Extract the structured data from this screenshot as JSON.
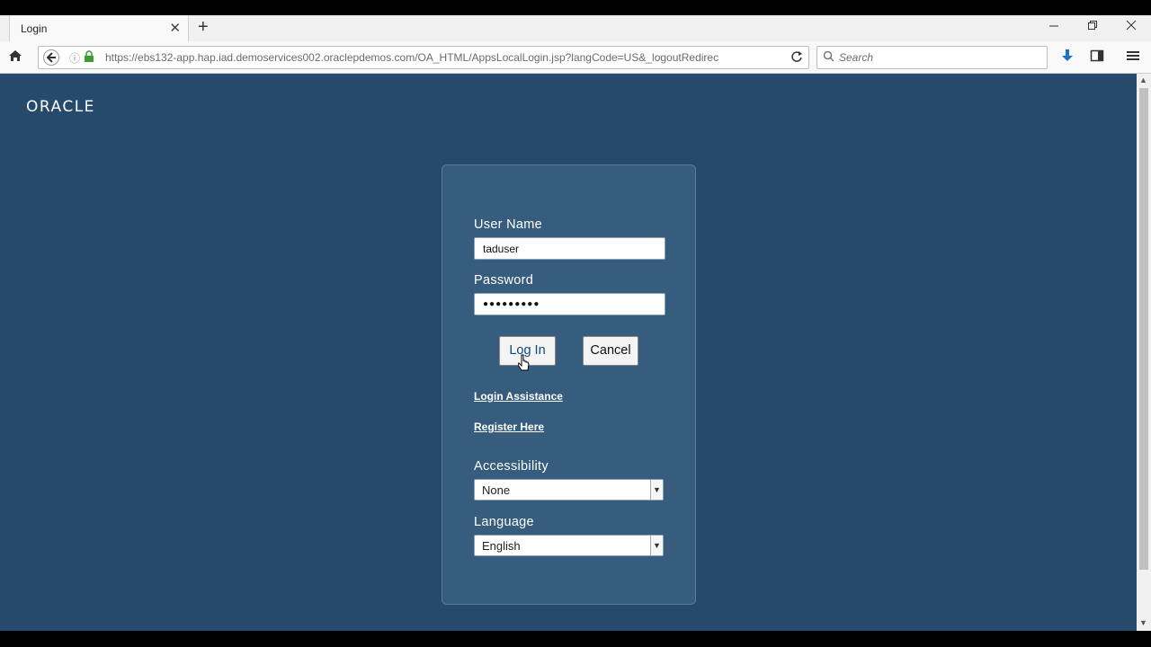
{
  "browser": {
    "tab_title": "Login",
    "tab_close": "✕",
    "new_tab": "+",
    "url": "https://ebs132-app.hap.iad.demoservices002.oraclepdemos.com/OA_HTML/AppsLocalLogin.jsp?langCode=US&_logoutRedirec",
    "search_placeholder": "Search"
  },
  "page": {
    "logo": "ORACLE",
    "username_label": "User Name",
    "username_value": "taduser",
    "password_label": "Password",
    "password_value": "●●●●●●●●●",
    "login_button": "Log In",
    "cancel_button": "Cancel",
    "login_assistance": "Login Assistance",
    "register_here": "Register Here",
    "accessibility_label": "Accessibility",
    "accessibility_value": "None",
    "language_label": "Language",
    "language_value": "English"
  },
  "colors": {
    "background": "#264a6b",
    "panel": "#365c7e",
    "accent": "#0b4a7d"
  }
}
